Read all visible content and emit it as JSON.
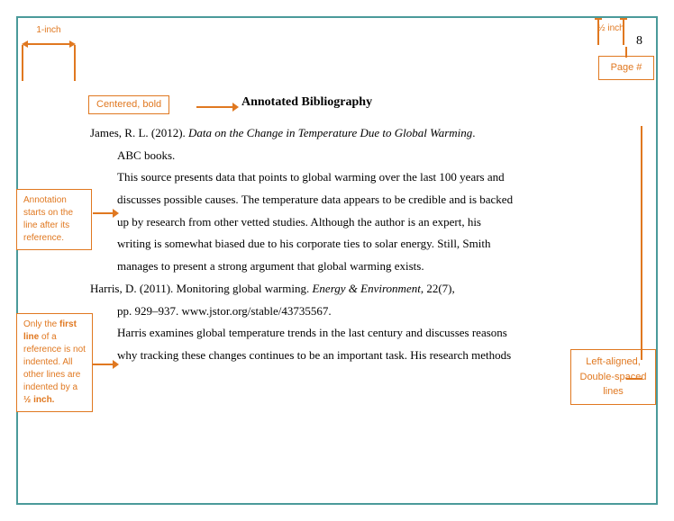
{
  "page": {
    "title": "Annotated Bibliography",
    "page_number": "8",
    "page_label": "Page #"
  },
  "annotations": {
    "half_inch": "½ inch",
    "one_inch": "1-inch",
    "centered_bold": "Centered, bold",
    "annotation_starts": "Annotation starts on the line after its reference.",
    "first_line_note": "Only the first line of a reference is not indented. All other lines are indented by a ½ inch.",
    "left_aligned": "Left-aligned, Double-spaced lines"
  },
  "references": [
    {
      "id": "ref1",
      "citation": "James, R. L. (2012). ",
      "title": "Data on the Change in Temperature Due to Global Warming",
      "after_title": ". ABC books.",
      "annotation": "This source presents data that points to global warming over the last 100 years and discusses possible causes. The temperature data appears to be credible and is backed up by research from other vetted studies. Although the author is an expert, his writing is somewhat biased due to his corporate ties to solar energy. Still, Smith manages to present a strong argument that global warming exists."
    },
    {
      "id": "ref2",
      "citation_start": "Harris, D. (2011). Monitoring global warming. ",
      "journal": "Energy & Environment",
      "citation_end": ", 22(7), pp. 929–937. www.jstor.org/stable/43735567.",
      "annotation": "Harris examines global temperature trends in the last century and discusses reasons why tracking these changes continues to be an important task. His research methods"
    }
  ]
}
